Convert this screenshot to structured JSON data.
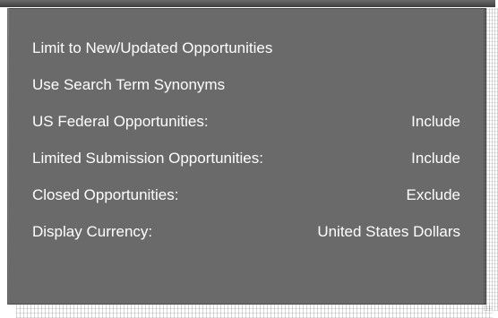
{
  "menu": {
    "items": [
      {
        "label": "Limit to New/Updated Opportunities",
        "value": ""
      },
      {
        "label": "Use Search Term Synonyms",
        "value": ""
      },
      {
        "label": "US Federal Opportunities:",
        "value": "Include"
      },
      {
        "label": "Limited Submission Opportunities:",
        "value": "Include"
      },
      {
        "label": "Closed Opportunities:",
        "value": "Exclude"
      },
      {
        "label": "Display Currency:",
        "value": "United States Dollars"
      }
    ]
  }
}
